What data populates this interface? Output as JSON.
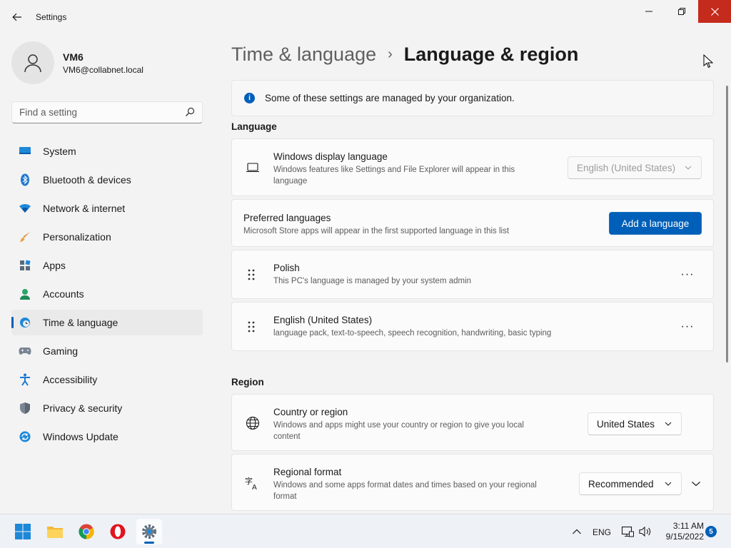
{
  "window": {
    "title": "Settings"
  },
  "profile": {
    "name": "VM6",
    "email": "VM6@collabnet.local"
  },
  "search": {
    "placeholder": "Find a setting"
  },
  "sidebar": {
    "items": [
      {
        "label": "System",
        "icon": "system-icon",
        "active": false
      },
      {
        "label": "Bluetooth & devices",
        "icon": "bluetooth-icon",
        "active": false
      },
      {
        "label": "Network & internet",
        "icon": "wifi-icon",
        "active": false
      },
      {
        "label": "Personalization",
        "icon": "brush-icon",
        "active": false
      },
      {
        "label": "Apps",
        "icon": "apps-icon",
        "active": false
      },
      {
        "label": "Accounts",
        "icon": "person-icon",
        "active": false
      },
      {
        "label": "Time & language",
        "icon": "clock-globe-icon",
        "active": true
      },
      {
        "label": "Gaming",
        "icon": "controller-icon",
        "active": false
      },
      {
        "label": "Accessibility",
        "icon": "accessibility-icon",
        "active": false
      },
      {
        "label": "Privacy & security",
        "icon": "shield-icon",
        "active": false
      },
      {
        "label": "Windows Update",
        "icon": "update-icon",
        "active": false
      }
    ]
  },
  "breadcrumb": {
    "parent": "Time & language",
    "separator": "›",
    "current": "Language & region"
  },
  "info_banner": {
    "text": "Some of these settings are managed by your organization."
  },
  "language_section": {
    "heading": "Language",
    "display_language": {
      "title": "Windows display language",
      "description": "Windows features like Settings and File Explorer will appear in this language",
      "value": "English (United States)"
    },
    "preferred": {
      "title": "Preferred languages",
      "description": "Microsoft Store apps will appear in the first supported language in this list",
      "button": "Add a language"
    },
    "languages": [
      {
        "name": "Polish",
        "detail": "This PC's language is managed by your system admin",
        "more": "···"
      },
      {
        "name": "English (United States)",
        "detail": "language pack, text-to-speech, speech recognition, handwriting, basic typing",
        "more": "···"
      }
    ]
  },
  "region_section": {
    "heading": "Region",
    "country": {
      "title": "Country or region",
      "description": "Windows and apps might use your country or region to give you local content",
      "value": "United States"
    },
    "format": {
      "title": "Regional format",
      "description": "Windows and some apps format dates and times based on your regional format",
      "value": "Recommended"
    }
  },
  "taskbar": {
    "apps": [
      "start-icon",
      "file-explorer-icon",
      "chrome-icon",
      "opera-icon",
      "settings-icon"
    ],
    "language_indicator": "ENG",
    "time": "3:11 AM",
    "date": "9/15/2022",
    "notification_count": "5"
  },
  "colors": {
    "accent": "#005fb8",
    "close_button": "#c42b1c",
    "background": "#f3f3f3"
  }
}
